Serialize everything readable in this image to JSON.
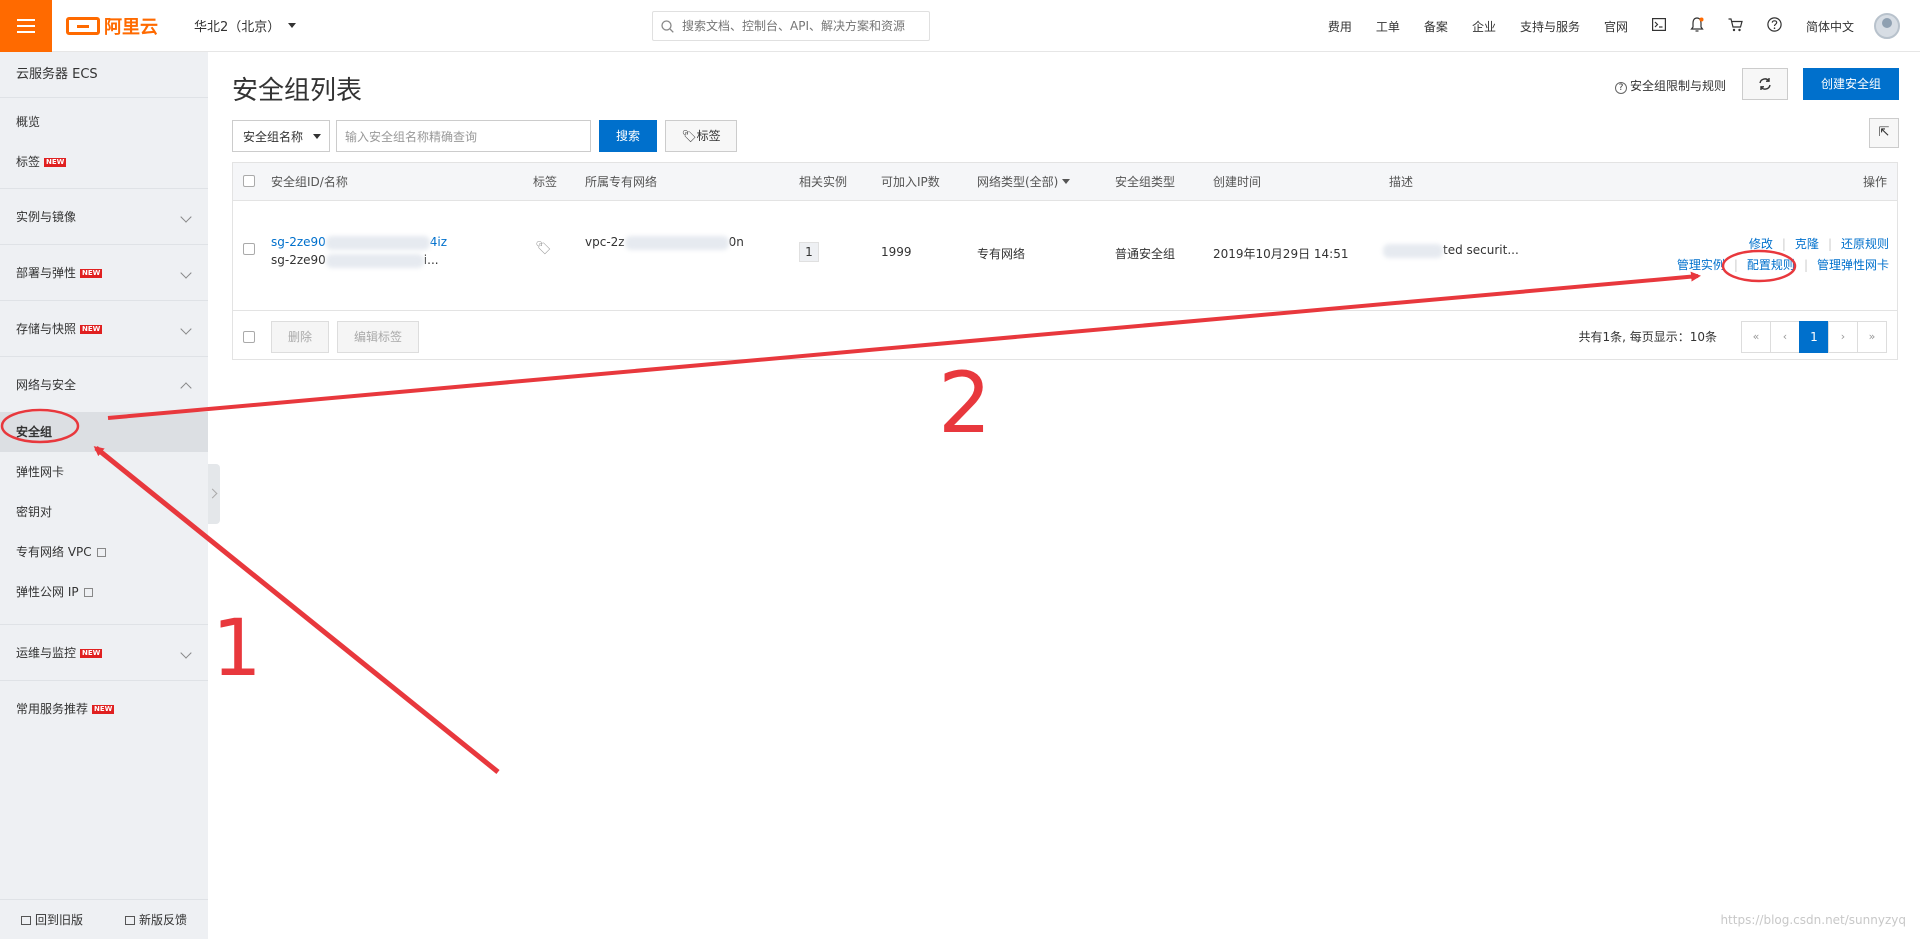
{
  "topbar": {
    "brand": "阿里云",
    "region": "华北2（北京）",
    "search_placeholder": "搜索文档、控制台、API、解决方案和资源",
    "nav": [
      "费用",
      "工单",
      "备案",
      "企业",
      "支持与服务",
      "官网"
    ],
    "language": "简体中文"
  },
  "sidebar": {
    "title": "云服务器 ECS",
    "overview": "概览",
    "tags": "标签",
    "groups": {
      "instances": "实例与镜像",
      "deploy": "部署与弹性",
      "storage": "存储与快照",
      "network": "网络与安全",
      "ops": "运维与监控",
      "common": "常用服务推荐"
    },
    "network_items": {
      "security_group": "安全组",
      "eni": "弹性网卡",
      "keypair": "密钥对",
      "vpc": "专有网络 VPC",
      "eip": "弹性公网 IP"
    },
    "new_badge": "NEW",
    "footer": {
      "back": "回到旧版",
      "feedback": "新版反馈"
    }
  },
  "main": {
    "title": "安全组列表",
    "help_link": "安全组限制与规则",
    "refresh_icon": "refresh-icon",
    "create_button": "创建安全组",
    "filter": {
      "select_value": "安全组名称",
      "input_placeholder": "输入安全组名称精确查询",
      "search_button": "搜索",
      "tag_button": "标签"
    },
    "table": {
      "headers": {
        "id_name": "安全组ID/名称",
        "tag": "标签",
        "vpc": "所属专有网络",
        "instances": "相关实例",
        "available_ip": "可加入IP数",
        "network_type": "网络类型(全部)",
        "sg_type": "安全组类型",
        "created": "创建时间",
        "desc": "描述",
        "actions": "操作"
      },
      "row": {
        "id_prefix": "sg-2ze90",
        "id_suffix": "4iz",
        "name_prefix": "sg-2ze90",
        "name_suffix": "i...",
        "vpc_prefix": "vpc-2z",
        "vpc_suffix": "0n",
        "instances": "1",
        "available_ip": "1999",
        "network_type": "专有网络",
        "sg_type": "普通安全组",
        "created": "2019年10月29日 14:51",
        "desc_suffix": "ted securit...",
        "actions": {
          "modify": "修改",
          "clone": "克隆",
          "restore": "还原规则",
          "manage_instances": "管理实例",
          "config_rules": "配置规则",
          "manage_eni": "管理弹性网卡"
        }
      },
      "footer": {
        "delete": "删除",
        "edit_tags": "编辑标签",
        "page_info": "共有1条, 每页显示：10条",
        "pages": [
          "«",
          "‹",
          "1",
          "›",
          "»"
        ]
      }
    }
  },
  "annotations": {
    "step1": "1",
    "step2": "2"
  },
  "watermark": "https://blog.csdn.net/sunnyzyq",
  "colors": {
    "brand": "#ff6a00",
    "primary": "#0070cc",
    "annotation": "#e8383d"
  }
}
